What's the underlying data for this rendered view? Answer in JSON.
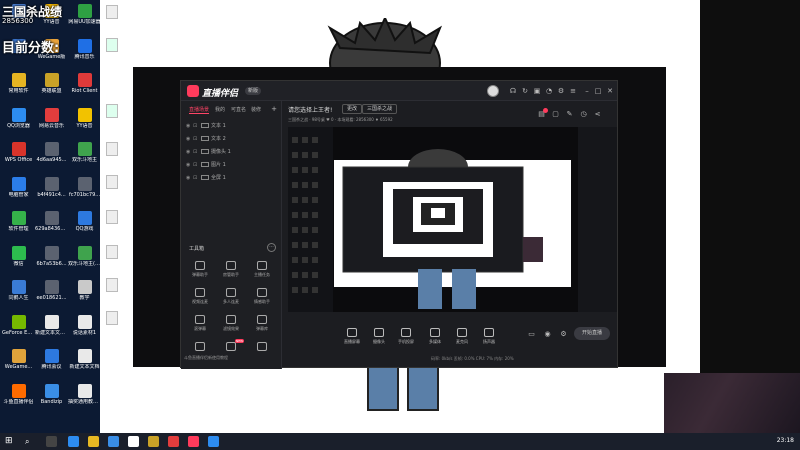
{
  "desktop": {
    "overlay_title": "三国杀战绩",
    "overlay_number": "2856300",
    "overlay_score": "目前分数:",
    "icons": [
      {
        "label": "",
        "color": "#4a7fd6"
      },
      {
        "label": "YY语音",
        "color": "#f0b400"
      },
      {
        "label": "网易UU加速器",
        "color": "#2ea043"
      },
      {
        "label": "",
        "color": "#3a73c9"
      },
      {
        "label": "WeGame版",
        "color": "#e8a23a"
      },
      {
        "label": "腾讯音乐",
        "color": "#1f6fe5"
      },
      {
        "label": "常用软件",
        "color": "#e6b422"
      },
      {
        "label": "英雄联盟",
        "color": "#c9a227"
      },
      {
        "label": "Riot Client",
        "color": "#e03a3a"
      },
      {
        "label": "QQ浏览器",
        "color": "#2d8cf0"
      },
      {
        "label": "网易云音乐",
        "color": "#e23d3d"
      },
      {
        "label": "YY语音",
        "color": "#f2c200"
      },
      {
        "label": "WPS Office",
        "color": "#d9342b"
      },
      {
        "label": "4d6aa945...",
        "color": "#5b6270"
      },
      {
        "label": "双乐斗地主",
        "color": "#3fa34d"
      },
      {
        "label": "电脑管家",
        "color": "#2b7de9"
      },
      {
        "label": "b4f491c4...",
        "color": "#5b6270"
      },
      {
        "label": "fc701bc79...",
        "color": "#5b6270"
      },
      {
        "label": "软件管理",
        "color": "#35b24a"
      },
      {
        "label": "629a84366...",
        "color": "#5b6270"
      },
      {
        "label": "QQ游戏",
        "color": "#2d79e0"
      },
      {
        "label": "微信",
        "color": "#2dbb4e"
      },
      {
        "label": "6b7a53b6...",
        "color": "#5b6270"
      },
      {
        "label": "双乐斗地主(腾讯电脑版)",
        "color": "#3fa34d"
      },
      {
        "label": "同鹅人生",
        "color": "#3a7bd5"
      },
      {
        "label": "ee018621...",
        "color": "#5b6270"
      },
      {
        "label": "教学",
        "color": "#c9c9c9"
      },
      {
        "label": "GeForce Experience",
        "color": "#76b900"
      },
      {
        "label": "新建文本文档(2)",
        "color": "#e9e9e9"
      },
      {
        "label": "说话素材1",
        "color": "#e9e9e9"
      },
      {
        "label": "WeGame...",
        "color": "#e0a33b"
      },
      {
        "label": "腾讯会议",
        "color": "#2d79e0"
      },
      {
        "label": "新建文本文档",
        "color": "#e9e9e9"
      },
      {
        "label": "斗鱼直播伴侣",
        "color": "#ff6b00"
      },
      {
        "label": "Bandizip",
        "color": "#3a8ee6"
      },
      {
        "label": "抽奖通用教学1",
        "color": "#e9e9e9"
      }
    ]
  },
  "app": {
    "name": "直播伴侣",
    "version": "新版",
    "tabs": [
      "直播场景",
      "我的",
      "可直名",
      "装修"
    ],
    "sources": [
      {
        "label": "文本 1"
      },
      {
        "label": "文本 2"
      },
      {
        "label": "摄像头 1"
      },
      {
        "label": "图片 1"
      },
      {
        "label": "全屏 1"
      }
    ],
    "tools_title": "工具箱",
    "tools_more": "···",
    "tools": [
      "弹幕助手",
      "房管助手",
      "主播任务",
      "视频连麦",
      "多人连麦",
      "情感助手",
      "滚弹幕",
      "滤镜效果",
      "弹幕库",
      "",
      "",
      ""
    ],
    "tool_badge": "NEW",
    "bottom_ad": "斗鱼直播伴侣新使用教程",
    "stream_title": "请您选择上王者!",
    "change_btn": "更改",
    "category": "三国杀之战",
    "row2_text": "三国杀之战 · 98号桌   ♥ 0 · 本场观看: 2856300   ♦ 65592",
    "bottom_tools": [
      "直播屏幕",
      "摄像头",
      "手机投屏",
      "多媒体",
      "麦克风",
      "扬声器"
    ],
    "live_btn": "开始直播",
    "status": "码率: 0kb/s  丢帧: 0.0%  CPU: 7%  内存: 20%"
  },
  "taskbar": {
    "time": "23:18"
  }
}
